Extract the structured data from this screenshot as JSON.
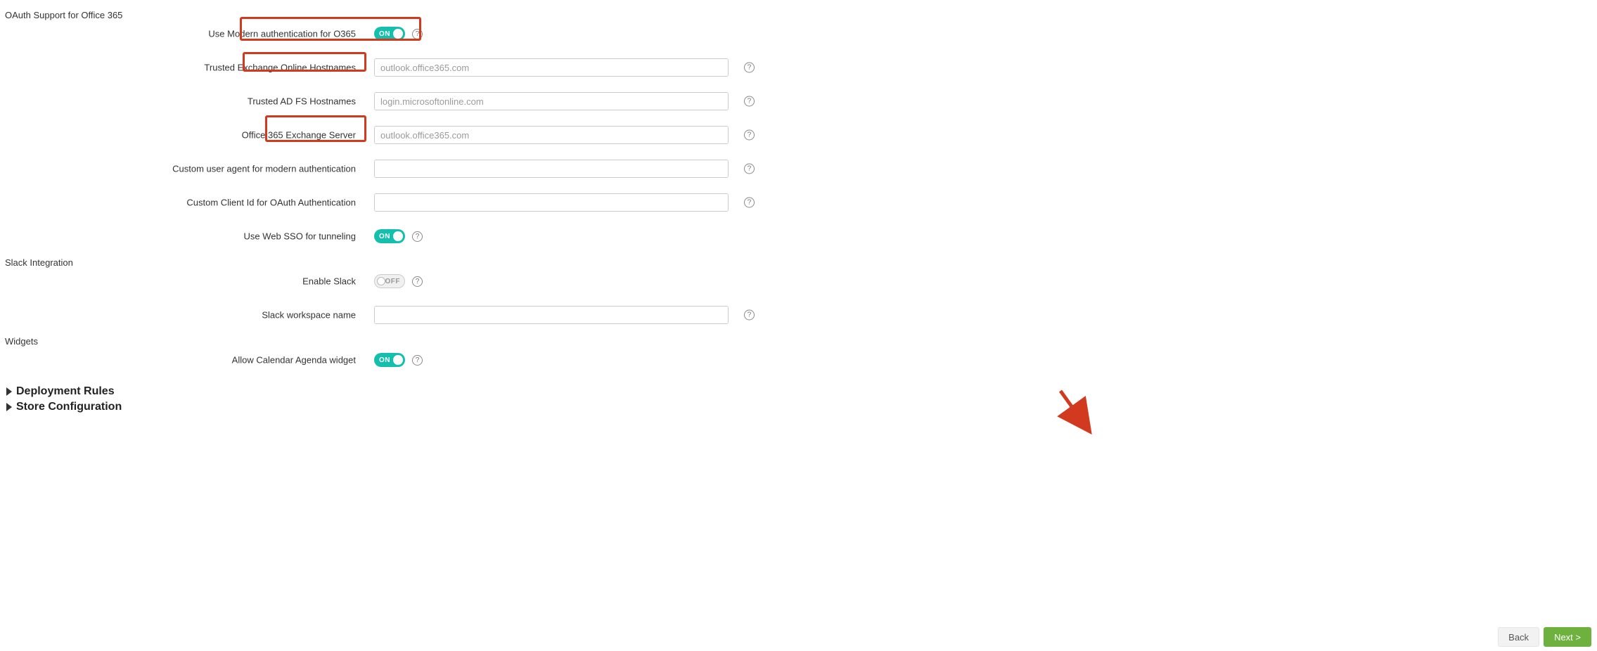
{
  "sections": {
    "oauth_title": "OAuth Support for Office 365",
    "slack_title": "Slack Integration",
    "widgets_title": "Widgets"
  },
  "rows": {
    "modern_auth": {
      "label": "Use Modern authentication for O365",
      "toggle": "ON"
    },
    "trusted_exchange": {
      "label": "Trusted Exchange Online Hostnames",
      "placeholder": "outlook.office365.com",
      "value": ""
    },
    "trusted_adfs": {
      "label": "Trusted AD FS Hostnames",
      "placeholder": "login.microsoftonline.com",
      "value": ""
    },
    "o365_exchange": {
      "label": "Office 365 Exchange Server",
      "placeholder": "outlook.office365.com",
      "value": ""
    },
    "custom_ua": {
      "label": "Custom user agent for modern authentication",
      "placeholder": "",
      "value": ""
    },
    "custom_client": {
      "label": "Custom Client Id for OAuth Authentication",
      "placeholder": "",
      "value": ""
    },
    "web_sso": {
      "label": "Use Web SSO for tunneling",
      "toggle": "ON"
    },
    "enable_slack": {
      "label": "Enable Slack",
      "toggle": "OFF"
    },
    "slack_ws": {
      "label": "Slack workspace name",
      "placeholder": "",
      "value": ""
    },
    "calendar_widget": {
      "label": "Allow Calendar Agenda widget",
      "toggle": "ON"
    }
  },
  "expanders": {
    "deployment": "Deployment Rules",
    "store": "Store Configuration"
  },
  "footer": {
    "back": "Back",
    "next": "Next >"
  }
}
